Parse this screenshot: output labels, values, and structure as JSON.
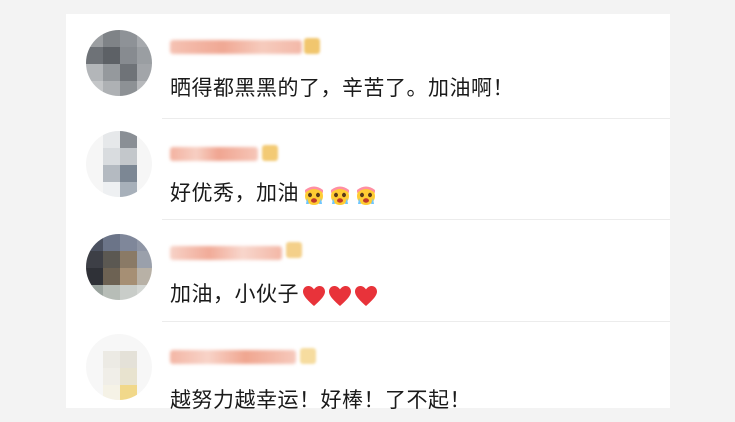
{
  "comments": [
    {
      "text": "晒得都黑黑的了，辛苦了。加油啊！",
      "emoji_count": 0,
      "emoji_name": ""
    },
    {
      "text": "好优秀，加油",
      "emoji_count": 3,
      "emoji_name": "crying-face-icon"
    },
    {
      "text": "加油，小伙子",
      "emoji_count": 3,
      "emoji_name": "red-heart-icon"
    },
    {
      "text": "越努力越幸运！好棒！了不起！",
      "emoji_count": 0,
      "emoji_name": ""
    }
  ],
  "colors": {
    "page_background": "#f3f3f3",
    "card_background": "#ffffff",
    "text": "#1a1a1a",
    "name_blur": "#f3b8a8",
    "badge": "#f3cc7a",
    "heart": "#e8333a",
    "emoji_face": "#ffcc33",
    "emoji_hair": "#ff8fa3"
  }
}
